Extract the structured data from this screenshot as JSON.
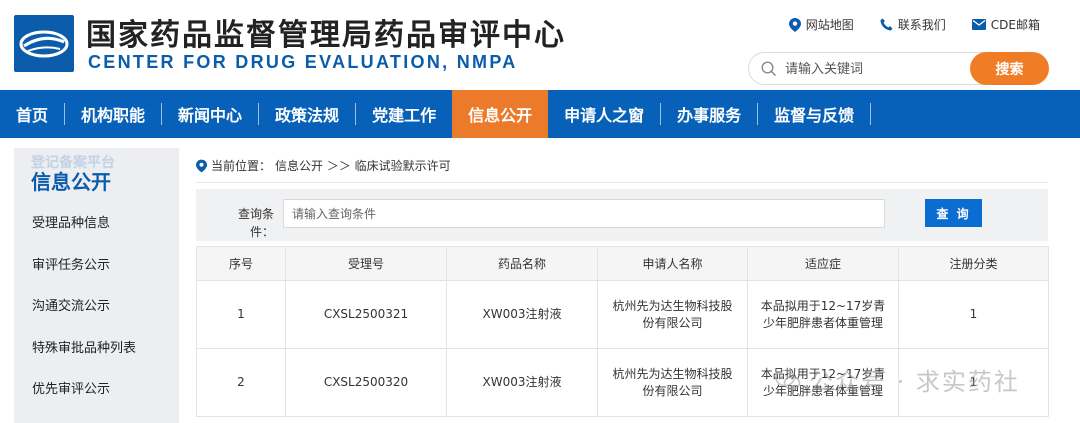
{
  "header": {
    "title_cn": "国家药品监督管理局药品审评中心",
    "title_en": "CENTER FOR DRUG EVALUATION, NMPA",
    "links": [
      {
        "label": "网站地图",
        "icon": "map-pin-icon"
      },
      {
        "label": "联系我们",
        "icon": "phone-icon"
      },
      {
        "label": "CDE邮箱",
        "icon": "mail-icon"
      }
    ],
    "search": {
      "placeholder": "请输入关键词",
      "button": "搜索"
    }
  },
  "nav": {
    "items": [
      "首页",
      "机构职能",
      "新闻中心",
      "政策法规",
      "党建工作",
      "信息公开",
      "申请人之窗",
      "办事服务",
      "监督与反馈"
    ],
    "active": "信息公开"
  },
  "sidebar": {
    "banner_text": "登记备案平台",
    "title": "信息公开",
    "items": [
      "受理品种信息",
      "审评任务公示",
      "沟通交流公示",
      "特殊审批品种列表",
      "优先审评公示"
    ]
  },
  "breadcrumb": {
    "prefix": "当前位置：",
    "path": "信息公开 ＞＞ 临床试验默示许可"
  },
  "query": {
    "label": "查询条件：",
    "placeholder": "请输入查询条件",
    "button": "查 询"
  },
  "table": {
    "headers": [
      "序号",
      "受理号",
      "药品名称",
      "申请人名称",
      "适应症",
      "注册分类"
    ],
    "rows": [
      [
        "1",
        "CXSL2500321",
        "XW003注射液",
        "杭州先为达生物科技股份有限公司",
        "本品拟用于12~17岁青少年肥胖患者体重管理",
        "1"
      ],
      [
        "2",
        "CXSL2500320",
        "XW003注射液",
        "杭州先为达生物科技股份有限公司",
        "本品拟用于12~17岁青少年肥胖患者体重管理",
        "1"
      ]
    ]
  },
  "watermark": {
    "text": "公众号 · 求实药社"
  },
  "colors": {
    "nav_blue": "#0861b9",
    "accent_orange": "#ec7a2b",
    "brand_blue": "#0b5cab"
  }
}
